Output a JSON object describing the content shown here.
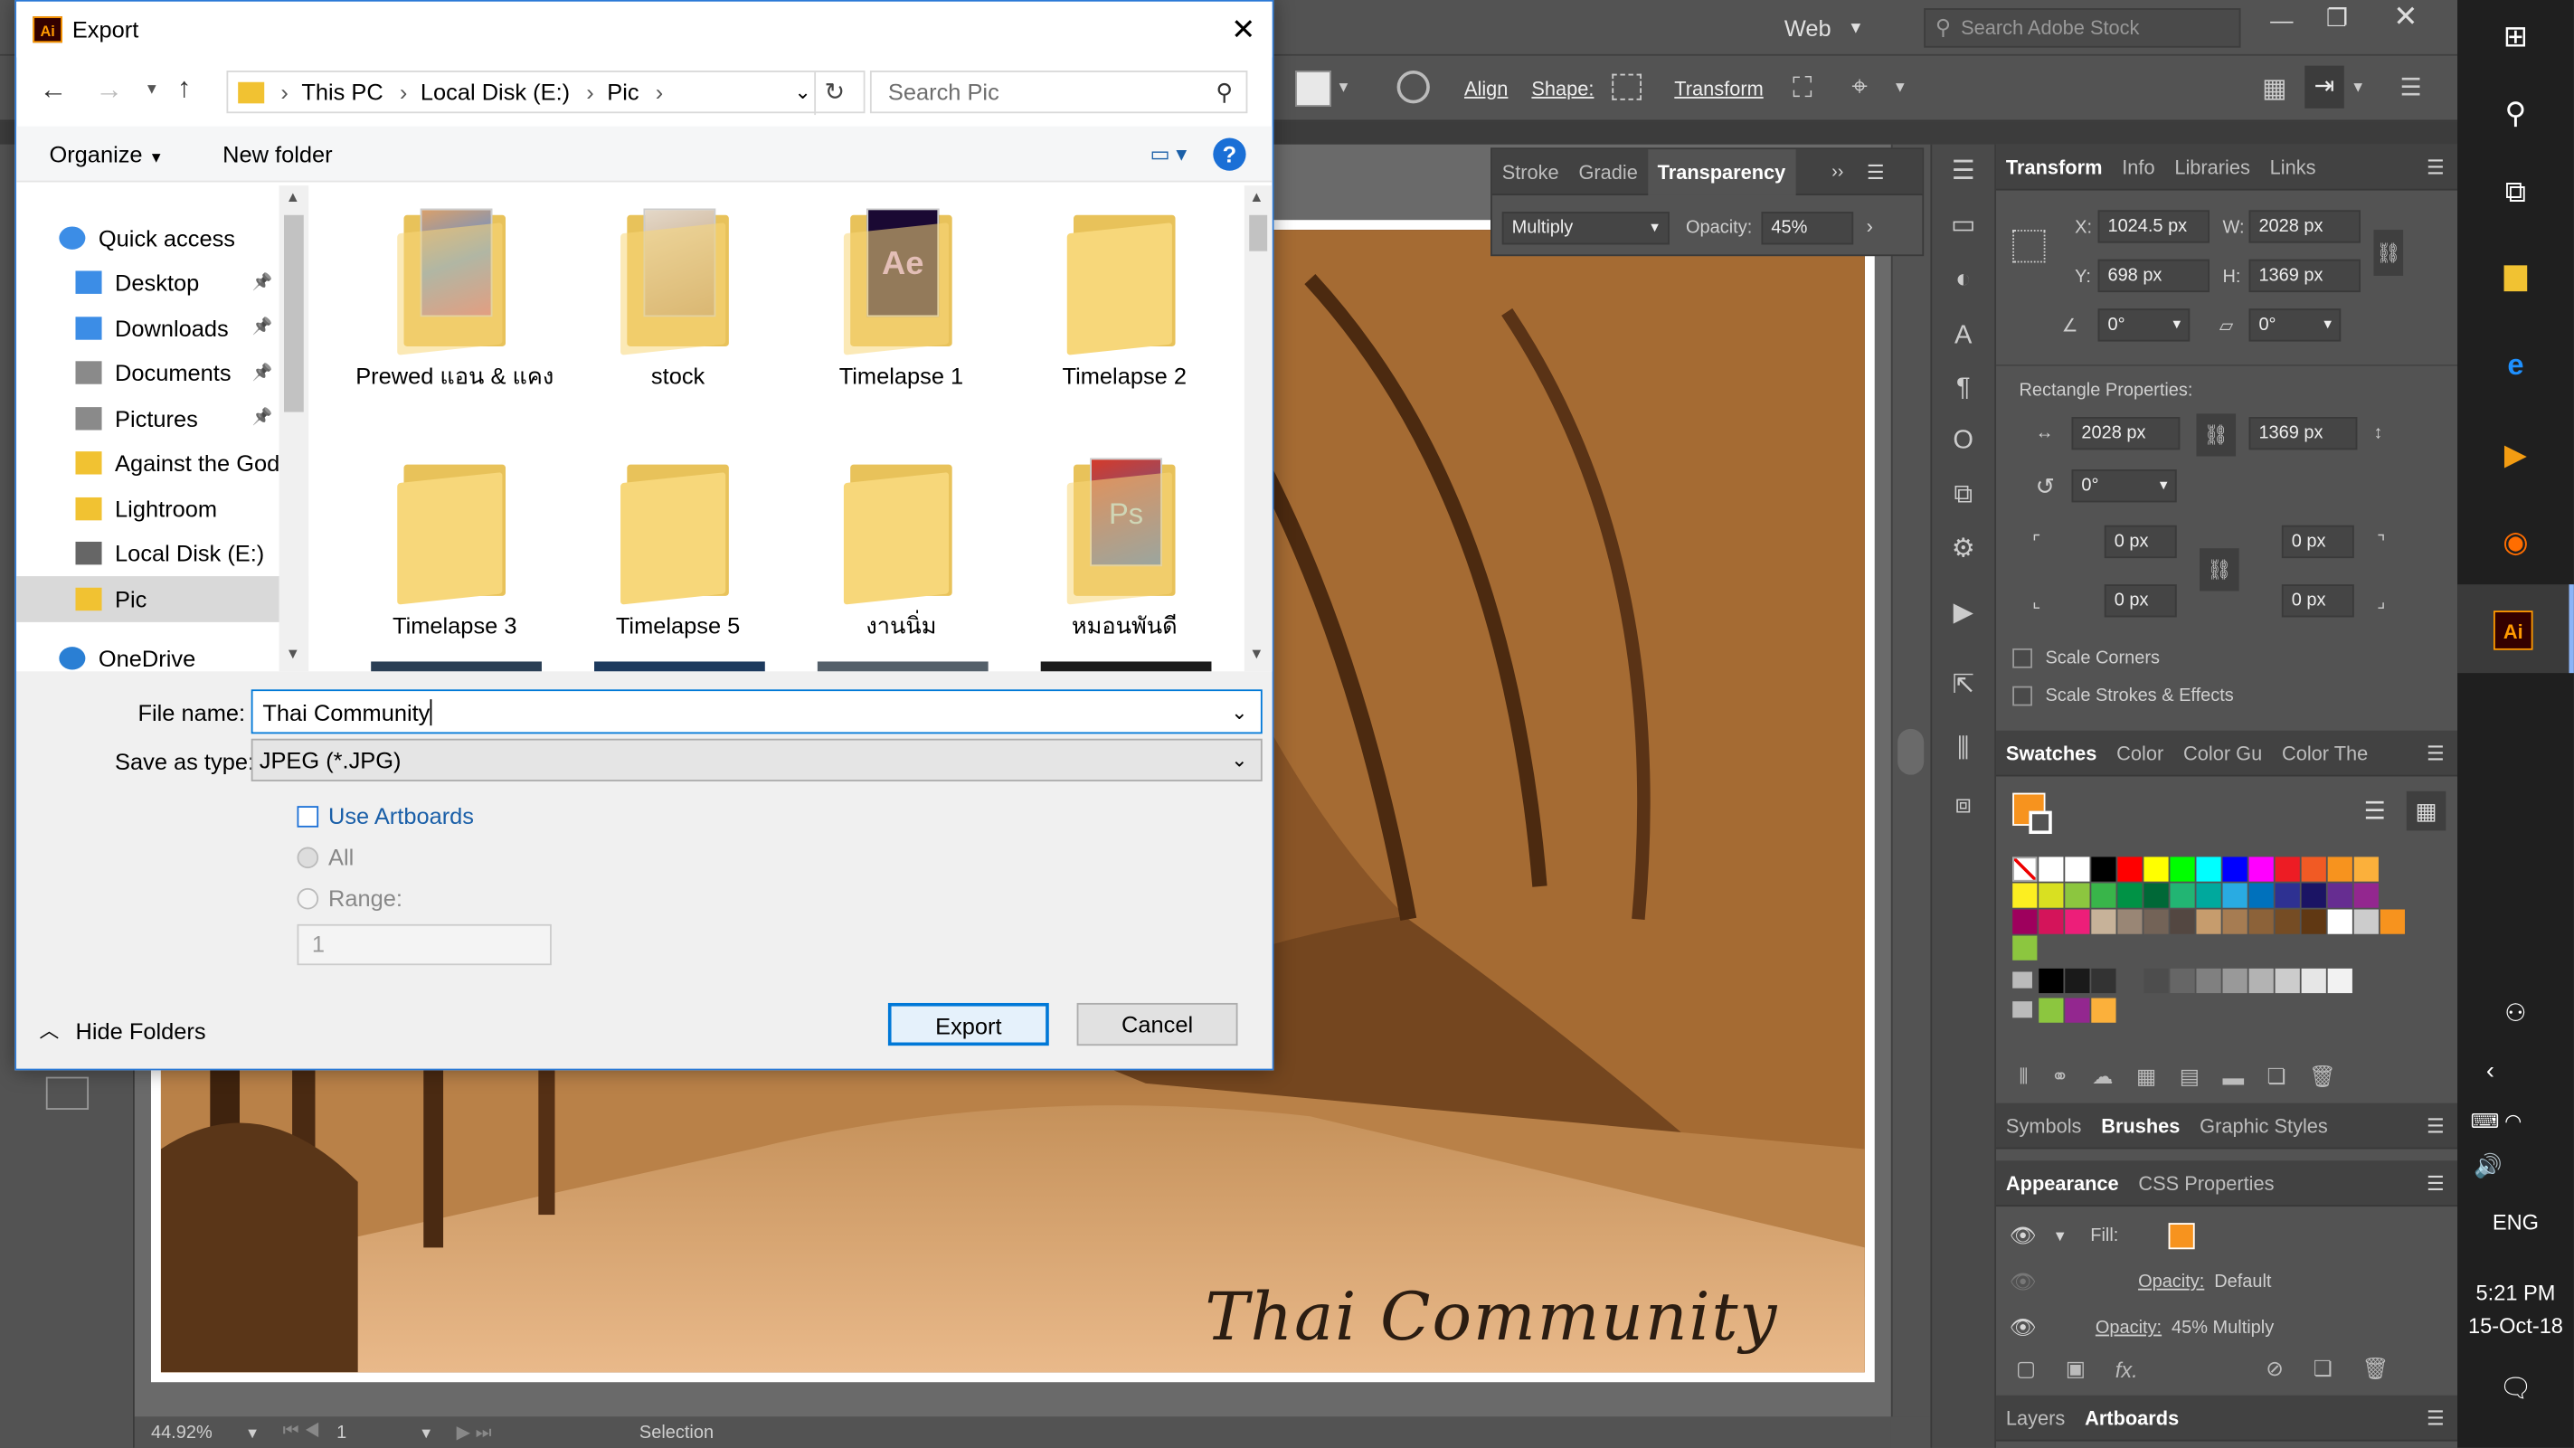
{
  "app": {
    "workspace": "Web",
    "search_stock_placeholder": "Search Adobe Stock",
    "control": {
      "align": "Align",
      "shape": "Shape:",
      "transform": "Transform"
    },
    "zoom": "44.92%",
    "artboard_num": "1",
    "tool_status": "Selection",
    "artwork_text": "Thai Community"
  },
  "transparency_panel": {
    "tabs": [
      "Stroke",
      "Gradie",
      "Transparency"
    ],
    "blend_mode": "Multiply",
    "opacity_label": "Opacity:",
    "opacity_value": "45%"
  },
  "transform_panel": {
    "tabs": [
      "Transform",
      "Info",
      "Libraries",
      "Links"
    ],
    "x_label": "X:",
    "x": "1024.5 px",
    "y_label": "Y:",
    "y": "698 px",
    "w_label": "W:",
    "w": "2028 px",
    "h_label": "H:",
    "h": "1369 px",
    "angle": "0°",
    "shear": "0°",
    "rect_props_label": "Rectangle Properties:",
    "rect_w": "2028 px",
    "rect_h": "1369 px",
    "rect_angle": "0°",
    "corner_tl": "0 px",
    "corner_tr": "0 px",
    "corner_bl": "0 px",
    "corner_br": "0 px",
    "scale_corners": "Scale Corners",
    "scale_strokes": "Scale Strokes & Effects"
  },
  "swatches_panel": {
    "tabs": [
      "Swatches",
      "Color",
      "Color Gu",
      "Color The"
    ],
    "row1": [
      "#ffffff",
      "#ffffff",
      "#000000",
      "#ff0000",
      "#ffff00",
      "#00ff00",
      "#00ffff",
      "#0000ff",
      "#ff00ff",
      "#ed1c24",
      "#f15a24",
      "#f7931e",
      "#fbb03b"
    ],
    "row2": [
      "#fcee21",
      "#d9e021",
      "#8cc63f",
      "#39b54a",
      "#009245",
      "#006837",
      "#22b573",
      "#00a99d",
      "#29abe2",
      "#0071bc",
      "#2e3192",
      "#1b1464",
      "#662d91",
      "#93278f"
    ],
    "row3": [
      "#9e005d",
      "#d4145a",
      "#ed1e79",
      "#c7b299",
      "#998675",
      "#736357",
      "#534741",
      "#c69c6d",
      "#a67c52",
      "#8c6239",
      "#754c24",
      "#603813",
      "#ffffff",
      "#cccccc",
      "#f7931e"
    ],
    "grays": [
      "#000000",
      "#1a1a1a",
      "#333333",
      "#4d4d4d",
      "#666666",
      "#808080",
      "#999999",
      "#b3b3b3",
      "#cccccc",
      "#e6e6e6",
      "#f2f2f2"
    ],
    "group2": [
      "#8cc63f",
      "#93278f",
      "#fbb03b"
    ]
  },
  "brushes_panel": {
    "tabs": [
      "Symbols",
      "Brushes",
      "Graphic Styles"
    ]
  },
  "appearance_panel": {
    "tabs": [
      "Appearance",
      "CSS Properties"
    ],
    "fill_label": "Fill:",
    "opacity1_label": "Opacity:",
    "opacity1_value": "Default",
    "opacity2_label": "Opacity:",
    "opacity2_value": "45% Multiply"
  },
  "layers_panel": {
    "tabs": [
      "Layers",
      "Artboards"
    ]
  },
  "dialog": {
    "title": "Export",
    "breadcrumb": [
      "This PC",
      "Local Disk (E:)",
      "Pic"
    ],
    "search_placeholder": "Search Pic",
    "organize": "Organize",
    "new_folder": "New folder",
    "nav": [
      {
        "label": "Quick access",
        "icon": "star-icon"
      },
      {
        "label": "Desktop",
        "icon": "desktop-icon",
        "pin": true
      },
      {
        "label": "Downloads",
        "icon": "downloads-icon",
        "pin": true
      },
      {
        "label": "Documents",
        "icon": "documents-icon",
        "pin": true
      },
      {
        "label": "Pictures",
        "icon": "pictures-icon",
        "pin": true
      },
      {
        "label": "Against the God",
        "icon": "folder-icon"
      },
      {
        "label": "Lightroom",
        "icon": "folder-icon"
      },
      {
        "label": "Local Disk (E:)",
        "icon": "drive-icon"
      },
      {
        "label": "Pic",
        "icon": "folder-icon"
      },
      {
        "label": "OneDrive",
        "icon": "onedrive-icon"
      }
    ],
    "files": [
      {
        "name": "Prewed แอน & แคง",
        "kind": "photos"
      },
      {
        "name": "stock",
        "kind": "stock"
      },
      {
        "name": "Timelapse 1",
        "kind": "ae"
      },
      {
        "name": "Timelapse 2",
        "kind": "plain"
      },
      {
        "name": "Timelapse 3",
        "kind": "plain"
      },
      {
        "name": "Timelapse 5",
        "kind": "plain"
      },
      {
        "name": "งานนิ่ม",
        "kind": "plain"
      },
      {
        "name": "หมอนพันดี",
        "kind": "ps"
      }
    ],
    "file_name_label": "File name:",
    "file_name_value": "Thai Community",
    "save_type_label": "Save as type:",
    "save_type_value": "JPEG (*.JPG)",
    "use_artboards": "Use Artboards",
    "all": "All",
    "range": "Range:",
    "range_value": "1",
    "hide_folders": "Hide Folders",
    "export_btn": "Export",
    "cancel_btn": "Cancel"
  },
  "taskbar": {
    "lang": "ENG",
    "time": "5:21 PM",
    "date": "15-Oct-18"
  }
}
